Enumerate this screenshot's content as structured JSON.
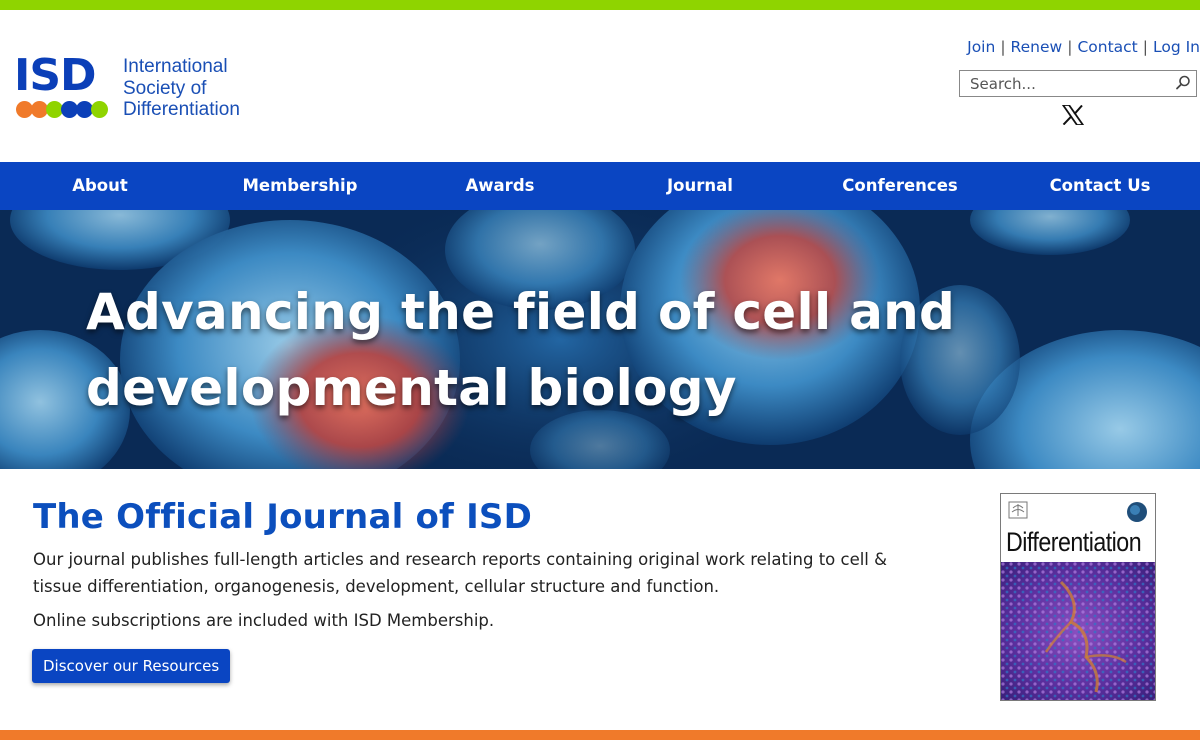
{
  "brand": {
    "acronym": "ISD",
    "name_lines": [
      "International",
      "Society of",
      "Differentiation"
    ],
    "dot_colors": [
      "#f07a2a",
      "#f07a2a",
      "#8fd400",
      "#0b3fb8",
      "#0b3fb8",
      "#8fd400"
    ]
  },
  "utility_nav": {
    "links": [
      "Join",
      "Renew",
      "Contact",
      "Log In"
    ],
    "separator": "|"
  },
  "search": {
    "placeholder": "Search..."
  },
  "social": {
    "icon": "x-twitter-icon"
  },
  "main_nav": {
    "items": [
      "About",
      "Membership",
      "Awards",
      "Journal",
      "Conferences",
      "Contact Us"
    ]
  },
  "hero": {
    "title": "Advancing the field of cell and developmental biology"
  },
  "journal_section": {
    "title": "The Official Journal of ISD",
    "description": "Our journal publishes full-length articles and research reports containing original work relating to cell & tissue differentiation, organogenesis, development, cellular structure and function.",
    "subscription_note": "Online subscriptions are included with ISD Membership.",
    "button_label": "Discover our Resources"
  },
  "journal_cover": {
    "title": "Differentiation",
    "publisher_logo": "elsevier-logo"
  },
  "colors": {
    "top_stripe": "#8fd400",
    "bottom_stripe": "#f07a2a",
    "nav_background": "#0a45c2",
    "heading_blue": "#0c4fbd"
  }
}
